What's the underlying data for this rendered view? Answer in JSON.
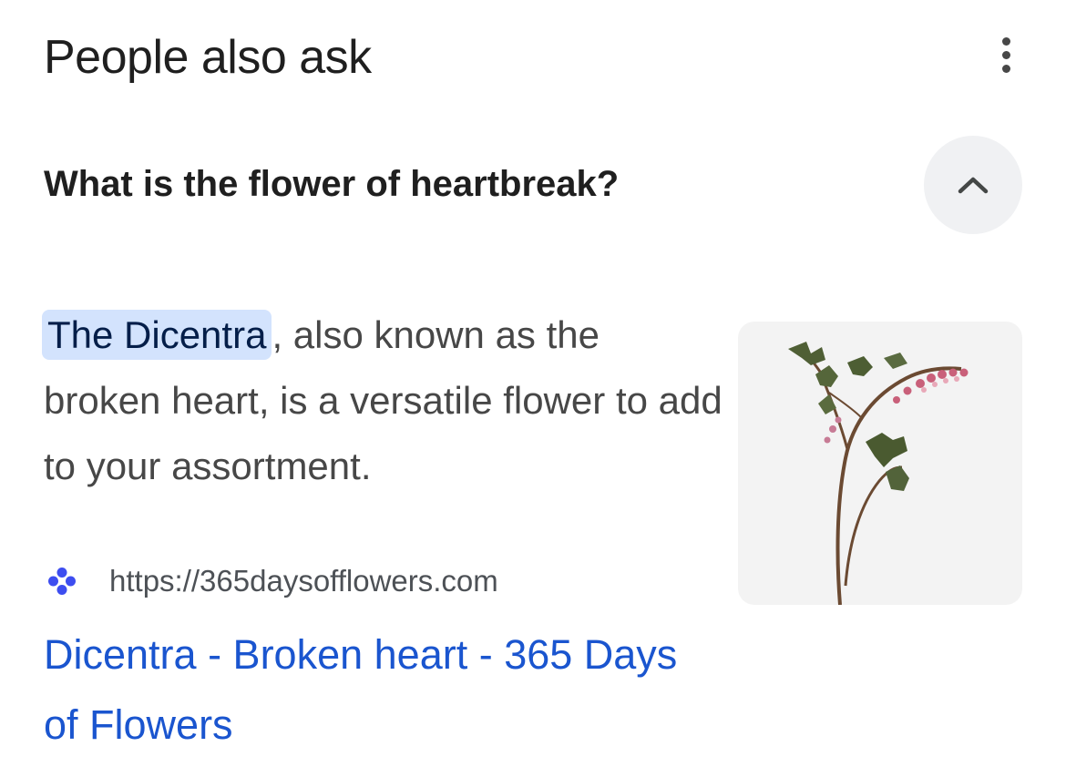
{
  "header": {
    "title": "People also ask"
  },
  "menu": {
    "icon": "more-vert-icon"
  },
  "question": {
    "text": "What is the flower of heartbreak?",
    "toggle_icon": "chevron-up-icon",
    "expanded": true
  },
  "answer": {
    "highlight": "The Dicentra",
    "text": ", also known as the broken heart, is a versatile flower to add to your assortment.",
    "image": "bleeding-heart-flower-image"
  },
  "source": {
    "favicon": "flower-favicon-icon",
    "url": "https://365daysofflowers.com",
    "title": "Dicentra - Broken heart - 365 Days of Flowers"
  },
  "colors": {
    "link": "#1a55cf",
    "highlight_bg": "#d3e3fd",
    "favicon": "#3d4df0"
  }
}
